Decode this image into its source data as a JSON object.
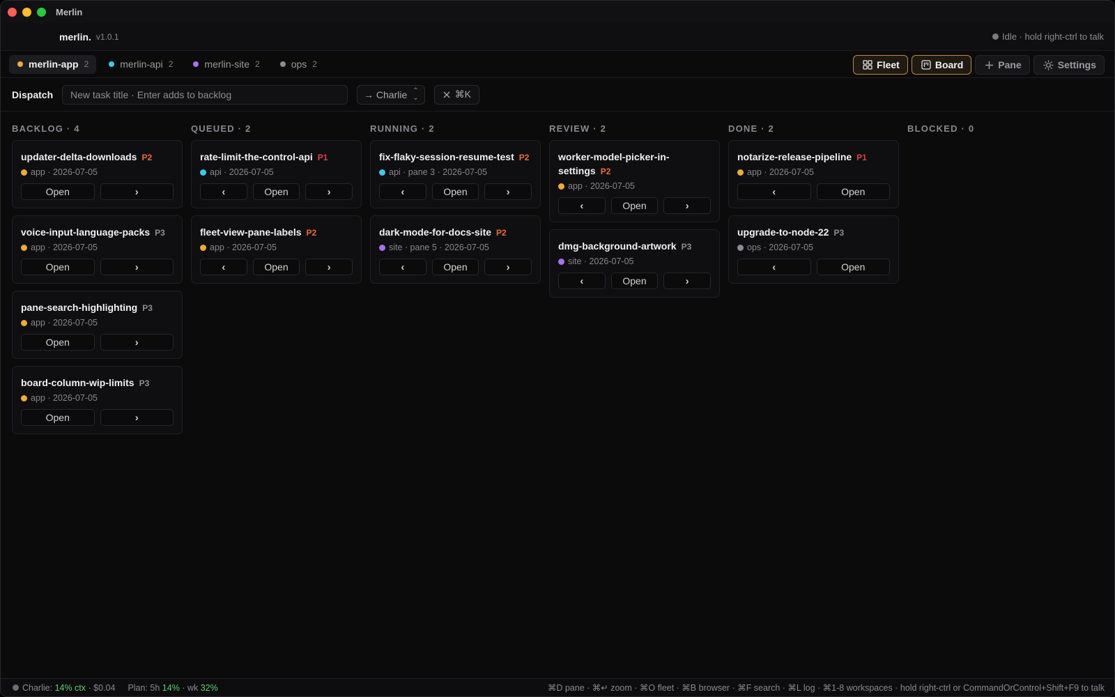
{
  "window": {
    "title": "Merlin"
  },
  "brand": {
    "name": "merlin.",
    "version": "v1.0.1"
  },
  "voice": {
    "status": "Idle · hold right-ctrl to talk"
  },
  "workspaces": [
    {
      "label": "merlin-app",
      "count": "2",
      "color": "#f0a93a",
      "active": true
    },
    {
      "label": "merlin-api",
      "count": "2",
      "color": "#3fc7ea",
      "active": false
    },
    {
      "label": "merlin-site",
      "count": "2",
      "color": "#a970f0",
      "active": false
    },
    {
      "label": "ops",
      "count": "2",
      "color": "#8d8d91",
      "active": false
    }
  ],
  "views": {
    "fleet": "Fleet",
    "board": "Board",
    "pane": "Pane",
    "settings": "Settings"
  },
  "dispatch": {
    "label": "Dispatch",
    "placeholder": "New task title · Enter adds to backlog",
    "assignee": "→ Charlie",
    "clear": "⌘K"
  },
  "board": {
    "columns": [
      {
        "header": "BACKLOG · 4",
        "cards": [
          {
            "title": "updater-delta-downloads",
            "priority": "P2",
            "meta": "app · 2026-07-05",
            "dot": "#f0a93a",
            "actions": [
              "Open",
              "›"
            ]
          },
          {
            "title": "voice-input-language-packs",
            "priority": "P3",
            "meta": "app · 2026-07-05",
            "dot": "#f0a93a",
            "actions": [
              "Open",
              "›"
            ]
          },
          {
            "title": "pane-search-highlighting",
            "priority": "P3",
            "meta": "app · 2026-07-05",
            "dot": "#f0a93a",
            "actions": [
              "Open",
              "›"
            ]
          },
          {
            "title": "board-column-wip-limits",
            "priority": "P3",
            "meta": "app · 2026-07-05",
            "dot": "#f0a93a",
            "actions": [
              "Open",
              "›"
            ]
          }
        ]
      },
      {
        "header": "QUEUED · 2",
        "cards": [
          {
            "title": "rate-limit-the-control-api",
            "priority": "P1",
            "meta": "api · 2026-07-05",
            "dot": "#3fc7ea",
            "actions": [
              "‹",
              "Open",
              "›"
            ]
          },
          {
            "title": "fleet-view-pane-labels",
            "priority": "P2",
            "meta": "app · 2026-07-05",
            "dot": "#f0a93a",
            "actions": [
              "‹",
              "Open",
              "›"
            ]
          }
        ]
      },
      {
        "header": "RUNNING · 2",
        "cards": [
          {
            "title": "fix-flaky-session-resume-test",
            "priority": "P2",
            "meta": "api · pane 3 · 2026-07-05",
            "dot": "#3fc7ea",
            "actions": [
              "‹",
              "Open",
              "›"
            ]
          },
          {
            "title": "dark-mode-for-docs-site",
            "priority": "P2",
            "meta": "site · pane 5 · 2026-07-05",
            "dot": "#a970f0",
            "actions": [
              "‹",
              "Open",
              "›"
            ]
          }
        ]
      },
      {
        "header": "REVIEW · 2",
        "cards": [
          {
            "title": "worker-model-picker-in-settings",
            "priority": "P2",
            "meta": "app · 2026-07-05",
            "dot": "#f0a93a",
            "actions": [
              "‹",
              "Open",
              "›"
            ]
          },
          {
            "title": "dmg-background-artwork",
            "priority": "P3",
            "meta": "site · 2026-07-05",
            "dot": "#a970f0",
            "actions": [
              "‹",
              "Open",
              "›"
            ]
          }
        ]
      },
      {
        "header": "DONE · 2",
        "cards": [
          {
            "title": "notarize-release-pipeline",
            "priority": "P1",
            "meta": "app · 2026-07-05",
            "dot": "#f0a93a",
            "actions": [
              "‹",
              "Open"
            ]
          },
          {
            "title": "upgrade-to-node-22",
            "priority": "P3",
            "meta": "ops · 2026-07-05",
            "dot": "#8d8d91",
            "actions": [
              "‹",
              "Open"
            ]
          }
        ]
      },
      {
        "header": "BLOCKED · 0",
        "cards": []
      }
    ]
  },
  "statusbar": {
    "agent": "Charlie:",
    "ctx": "14% ctx",
    "cost": "· $0.04",
    "plan_label": "Plan: 5h",
    "plan_5h": "14%",
    "wk_label": "· wk",
    "plan_wk": "32%",
    "shortcuts": "⌘D pane · ⌘↵ zoom · ⌘O fleet · ⌘B browser · ⌘F search · ⌘L log · ⌘1-8 workspaces · hold right-ctrl or CommandOrControl+Shift+F9 to talk"
  }
}
